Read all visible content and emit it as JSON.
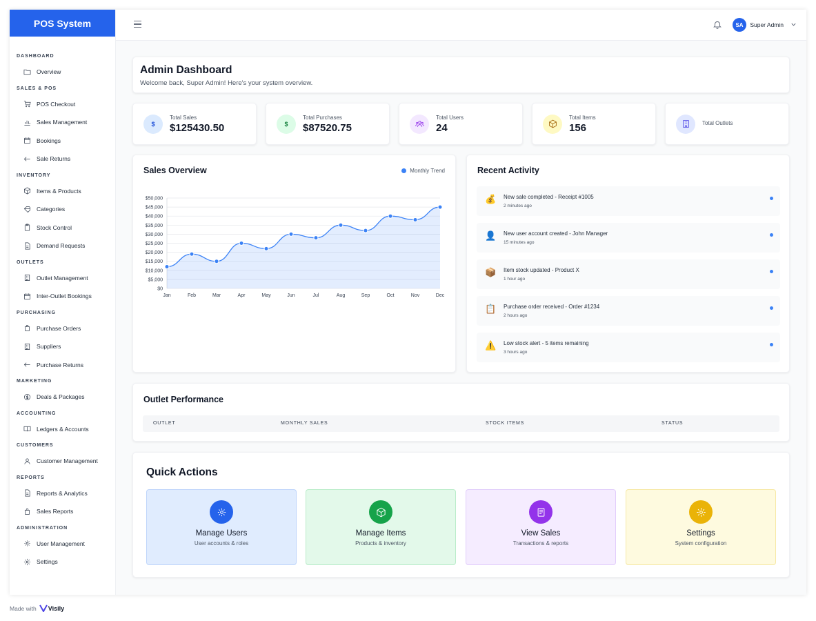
{
  "brand": "POS System",
  "sidebar": {
    "sections": [
      {
        "title": "DASHBOARD",
        "items": [
          {
            "label": "Overview",
            "icon": "folder-icon"
          }
        ]
      },
      {
        "title": "SALES & POS",
        "items": [
          {
            "label": "POS Checkout",
            "icon": "cart-icon"
          },
          {
            "label": "Sales Management",
            "icon": "bar-chart-icon"
          },
          {
            "label": "Bookings",
            "icon": "calendar-icon"
          },
          {
            "label": "Sale Returns",
            "icon": "arrow-left-icon"
          }
        ]
      },
      {
        "title": "INVENTORY",
        "items": [
          {
            "label": "Items & Products",
            "icon": "box-icon"
          },
          {
            "label": "Categories",
            "icon": "tag-icon"
          },
          {
            "label": "Stock Control",
            "icon": "clipboard-icon"
          },
          {
            "label": "Demand Requests",
            "icon": "document-icon"
          }
        ]
      },
      {
        "title": "OUTLETS",
        "items": [
          {
            "label": "Outlet Management",
            "icon": "building-icon"
          },
          {
            "label": "Inter-Outlet Bookings",
            "icon": "calendar-icon"
          }
        ]
      },
      {
        "title": "PURCHASING",
        "items": [
          {
            "label": "Purchase Orders",
            "icon": "bag-icon"
          },
          {
            "label": "Suppliers",
            "icon": "building-icon"
          },
          {
            "label": "Purchase Returns",
            "icon": "arrow-left-icon"
          }
        ]
      },
      {
        "title": "MARKETING",
        "items": [
          {
            "label": "Deals & Packages",
            "icon": "dollar-circle-icon"
          }
        ]
      },
      {
        "title": "ACCOUNTING",
        "items": [
          {
            "label": "Ledgers & Accounts",
            "icon": "book-icon"
          }
        ]
      },
      {
        "title": "CUSTOMERS",
        "items": [
          {
            "label": "Customer Management",
            "icon": "user-icon"
          }
        ]
      },
      {
        "title": "REPORTS",
        "items": [
          {
            "label": "Reports & Analytics",
            "icon": "document-icon"
          },
          {
            "label": "Sales Reports",
            "icon": "bag-icon"
          }
        ]
      },
      {
        "title": "ADMINISTRATION",
        "items": [
          {
            "label": "User Management",
            "icon": "users-gear-icon"
          },
          {
            "label": "Settings",
            "icon": "gear-icon"
          }
        ]
      }
    ]
  },
  "header": {
    "avatar_initials": "SA",
    "user_name": "Super Admin"
  },
  "welcome": {
    "title": "Admin Dashboard",
    "subtitle": "Welcome back, Super Admin! Here's your system overview."
  },
  "stats": [
    {
      "label": "Total Sales",
      "value": "$125430.50",
      "icon": "dollar-icon",
      "bg": "#dbeafe",
      "fg": "#1d4ed8"
    },
    {
      "label": "Total Purchases",
      "value": "$87520.75",
      "icon": "dollar-icon",
      "bg": "#dcfce7",
      "fg": "#15803d"
    },
    {
      "label": "Total Users",
      "value": "24",
      "icon": "users-icon",
      "bg": "#f3e8ff",
      "fg": "#9333ea"
    },
    {
      "label": "Total Items",
      "value": "156",
      "icon": "box-icon",
      "bg": "#fef9c3",
      "fg": "#a16207"
    },
    {
      "label": "Total Outlets",
      "value": "",
      "icon": "building-icon",
      "bg": "#e0e7ff",
      "fg": "#4f46e5"
    }
  ],
  "sales_overview": {
    "title": "Sales Overview",
    "legend": "Monthly Trend"
  },
  "chart_data": {
    "type": "area",
    "categories": [
      "Jan",
      "Feb",
      "Mar",
      "Apr",
      "May",
      "Jun",
      "Jul",
      "Aug",
      "Sep",
      "Oct",
      "Nov",
      "Dec"
    ],
    "series": [
      {
        "values": [
          12000,
          19000,
          15000,
          25000,
          22000,
          30000,
          28000,
          35000,
          32000,
          40000,
          38000,
          45000
        ]
      }
    ],
    "ylim": [
      0,
      50000
    ],
    "yticks": [
      "$50,000",
      "$45,000",
      "$40,000",
      "$35,000",
      "$30,000",
      "$25,000",
      "$20,000",
      "$15,000",
      "$10,000",
      "$5,000",
      "$0"
    ],
    "grid": true,
    "color": "#3b82f6"
  },
  "activity": {
    "title": "Recent Activity",
    "items": [
      {
        "icon": "money-bag-icon",
        "emoji": "💰",
        "text": "New sale completed - Receipt #1005",
        "time": "2 minutes ago"
      },
      {
        "icon": "user-icon",
        "emoji": "👤",
        "text": "New user account created - John Manager",
        "time": "15 minutes ago"
      },
      {
        "icon": "package-icon",
        "emoji": "📦",
        "text": "Item stock updated - Product X",
        "time": "1 hour ago"
      },
      {
        "icon": "clipboard-icon",
        "emoji": "📋",
        "text": "Purchase order received - Order #1234",
        "time": "2 hours ago"
      },
      {
        "icon": "warning-icon",
        "emoji": "⚠️",
        "text": "Low stock alert - 5 items remaining",
        "time": "3 hours ago"
      }
    ]
  },
  "outlet_performance": {
    "title": "Outlet Performance",
    "columns": [
      "OUTLET",
      "MONTHLY SALES",
      "STOCK ITEMS",
      "STATUS"
    ]
  },
  "quick_actions": {
    "title": "Quick Actions",
    "items": [
      {
        "title": "Manage Users",
        "subtitle": "User accounts & roles",
        "icon": "users-gear-icon",
        "circle": "#2563eb",
        "bg": "#e0ecfe",
        "border": "#bfd5fb"
      },
      {
        "title": "Manage Items",
        "subtitle": "Products & inventory",
        "icon": "box-icon",
        "circle": "#16a34a",
        "bg": "#e3f9ea",
        "border": "#b9ecc9"
      },
      {
        "title": "View Sales",
        "subtitle": "Transactions & reports",
        "icon": "receipt-icon",
        "circle": "#9333ea",
        "bg": "#f5ecff",
        "border": "#e1cdfb"
      },
      {
        "title": "Settings",
        "subtitle": "System configuration",
        "icon": "gear-icon",
        "circle": "#eab308",
        "bg": "#fefadf",
        "border": "#f6e8a4"
      }
    ]
  },
  "footer": {
    "made_with": "Made with",
    "logo_text": "Visily"
  }
}
